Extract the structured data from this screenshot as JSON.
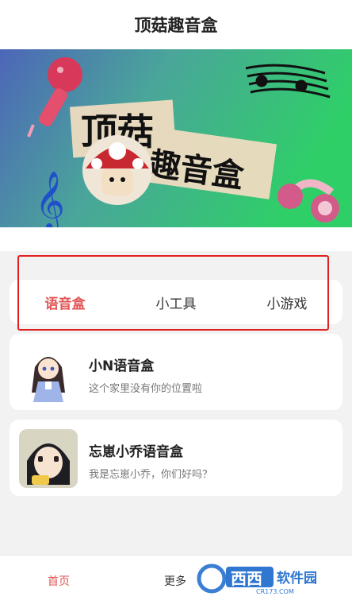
{
  "header": {
    "title": "顶菇趣音盒"
  },
  "banner": {
    "line1": "顶菇",
    "line2": "趣音盒"
  },
  "tabs": [
    {
      "label": "语音盒",
      "active": true
    },
    {
      "label": "小工具",
      "active": false
    },
    {
      "label": "小游戏",
      "active": false
    }
  ],
  "cards": [
    {
      "name": "小N语音盒",
      "desc": "这个家里没有你的位置啦"
    },
    {
      "name": "忘崽小乔语音盒",
      "desc": "我是忘崽小乔，你们好吗？"
    }
  ],
  "bottom_nav": {
    "home": "首页",
    "more": "更多"
  },
  "watermark": {
    "brand": "西西",
    "brand2": "软件园",
    "site": "CR173.COM"
  },
  "colors": {
    "accent": "#e25454",
    "highlight_border": "#e02020"
  }
}
